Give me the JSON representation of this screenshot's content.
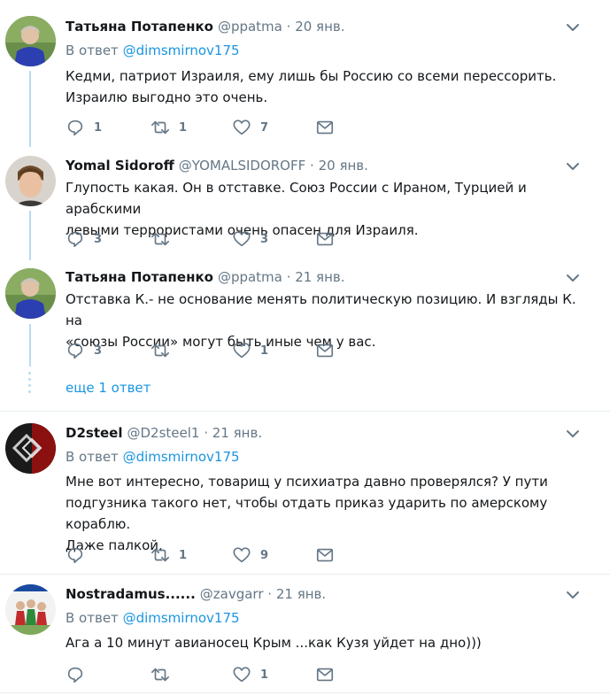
{
  "tweets": [
    {
      "name": "Татьяна Потапенко",
      "handle": "@ppatma",
      "dot": "·",
      "time": "20 янв.",
      "reply_prefix": "В ответ",
      "reply_mention": "@dimsmirnov175",
      "lines": [
        "Кедми, патриот Израиля, ему лишь бы Россию со всеми перессорить.",
        "Израилю выгодно это очень."
      ],
      "replies": "1",
      "retweets": "1",
      "likes": "7"
    },
    {
      "name": "Yomal Sidoroff",
      "handle": "@YOMALSIDOROFF",
      "dot": "·",
      "time": "20 янв.",
      "lines": [
        "Глупость какая. Он в отставке. Союз России с Ираном, Турцией и арабскими",
        "левыми террористами очень опасен для Израиля."
      ],
      "replies": "3",
      "retweets": "",
      "likes": "3"
    },
    {
      "name": "Татьяна Потапенко",
      "handle": "@ppatma",
      "dot": "·",
      "time": "21 янв.",
      "lines": [
        "Отставка К.- не основание менять политическую позицию. И взгляды К. на",
        "«союзы России» могут быть иные чем у вас."
      ],
      "replies": "3",
      "retweets": "",
      "likes": "1"
    },
    {
      "name": "D2steel",
      "handle": "@D2steel1",
      "dot": "·",
      "time": "21 янв.",
      "reply_prefix": "В ответ",
      "reply_mention": "@dimsmirnov175",
      "lines": [
        "Мне вот интересно, товарищ у психиатра давно проверялся? У пути",
        "подгузника такого нет, чтобы отдать приказ ударить по амерскому кораблю.",
        "Даже палкой."
      ],
      "replies": "",
      "retweets": "1",
      "likes": "9"
    },
    {
      "name": "Nostradamus......",
      "handle": "@zavgarr",
      "dot": "·",
      "time": "21 янв.",
      "reply_prefix": "В ответ",
      "reply_mention": "@dimsmirnov175",
      "lines": [
        "Ага а 10 минут авианосец Крым ...как Кузя уйдет на дно)))"
      ],
      "replies": "",
      "retweets": "",
      "likes": "1"
    }
  ],
  "more_replies": "еще 1 ответ",
  "colors": {
    "link": "#1b95e0",
    "secondary": "#657786",
    "thread_line": "#b8dcf2",
    "divider": "#e6ecf0"
  },
  "icons": [
    "reply-icon",
    "retweet-icon",
    "like-icon",
    "message-icon",
    "chevron-down-icon"
  ]
}
